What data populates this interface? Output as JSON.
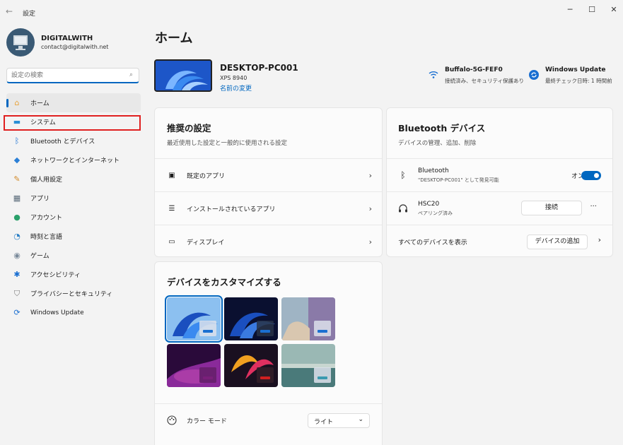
{
  "window": {
    "title": "設定",
    "minimize": "─",
    "maximize": "☐",
    "close": "✕"
  },
  "user": {
    "name": "DIGITALWITH",
    "email": "contact@digitalwith.net"
  },
  "search": {
    "placeholder": "設定の検索"
  },
  "nav": [
    {
      "label": "ホーム",
      "icon": "home-icon",
      "glyph": "⌂",
      "color": "#e8a33a"
    },
    {
      "label": "システム",
      "icon": "system-icon",
      "glyph": "▬",
      "color": "#2a8fd6"
    },
    {
      "label": "Bluetooth とデバイス",
      "icon": "bluetooth-icon",
      "glyph": "ᛒ",
      "color": "#1a6fd1"
    },
    {
      "label": "ネットワークとインターネット",
      "icon": "network-icon",
      "glyph": "◆",
      "color": "#2a7fd6"
    },
    {
      "label": "個人用設定",
      "icon": "brush-icon",
      "glyph": "✎",
      "color": "#d28a2a"
    },
    {
      "label": "アプリ",
      "icon": "apps-icon",
      "glyph": "▦",
      "color": "#5a6b7a"
    },
    {
      "label": "アカウント",
      "icon": "account-icon",
      "glyph": "●",
      "color": "#2aa06a"
    },
    {
      "label": "時刻と言語",
      "icon": "clock-globe-icon",
      "glyph": "◔",
      "color": "#2a7fc6"
    },
    {
      "label": "ゲーム",
      "icon": "gamepad-icon",
      "glyph": "◉",
      "color": "#7a8a9a"
    },
    {
      "label": "アクセシビリティ",
      "icon": "accessibility-icon",
      "glyph": "✱",
      "color": "#1a6fd1"
    },
    {
      "label": "プライバシーとセキュリティ",
      "icon": "shield-icon",
      "glyph": "⛉",
      "color": "#7a7a7a"
    },
    {
      "label": "Windows Update",
      "icon": "windows-update-icon",
      "glyph": "⟳",
      "color": "#1a6fd1"
    }
  ],
  "page": {
    "title": "ホーム"
  },
  "device": {
    "name": "DESKTOP-PC001",
    "model": "XPS 8940",
    "rename": "名前の変更"
  },
  "wifi": {
    "title": "Buffalo-5G-FEF0",
    "subtitle": "接続済み、セキュリティ保護あり"
  },
  "update": {
    "title": "Windows Update",
    "subtitle": "最終チェック日時: 1 時間前"
  },
  "recommended": {
    "title": "推奨の設定",
    "subtitle": "最近使用した設定と一般的に使用される設定",
    "items": [
      {
        "label": "既定のアプリ",
        "chevron": "›"
      },
      {
        "label": "インストールされているアプリ",
        "chevron": "›"
      },
      {
        "label": "ディスプレイ",
        "chevron": "›"
      }
    ]
  },
  "bluetooth": {
    "title": "Bluetooth デバイス",
    "subtitle": "デバイスの管理、追加、削除",
    "bt_label": "Bluetooth",
    "bt_sub": "\"DESKTOP-PC001\" として発見可能",
    "bt_state": "オン",
    "device_name": "HSC20",
    "device_status": "ペアリング済み",
    "connect": "接続",
    "more": "···",
    "show_all": "すべてのデバイスを表示",
    "add_device": "デバイスの追加",
    "chevron": "›"
  },
  "customize": {
    "title": "デバイスをカスタマイズする",
    "color_mode_label": "カラー モード",
    "color_mode_value": "ライト",
    "color_mode_chevron": "⌄"
  },
  "colors": {
    "accent": "#0067c0",
    "highlight": "#e02020"
  }
}
